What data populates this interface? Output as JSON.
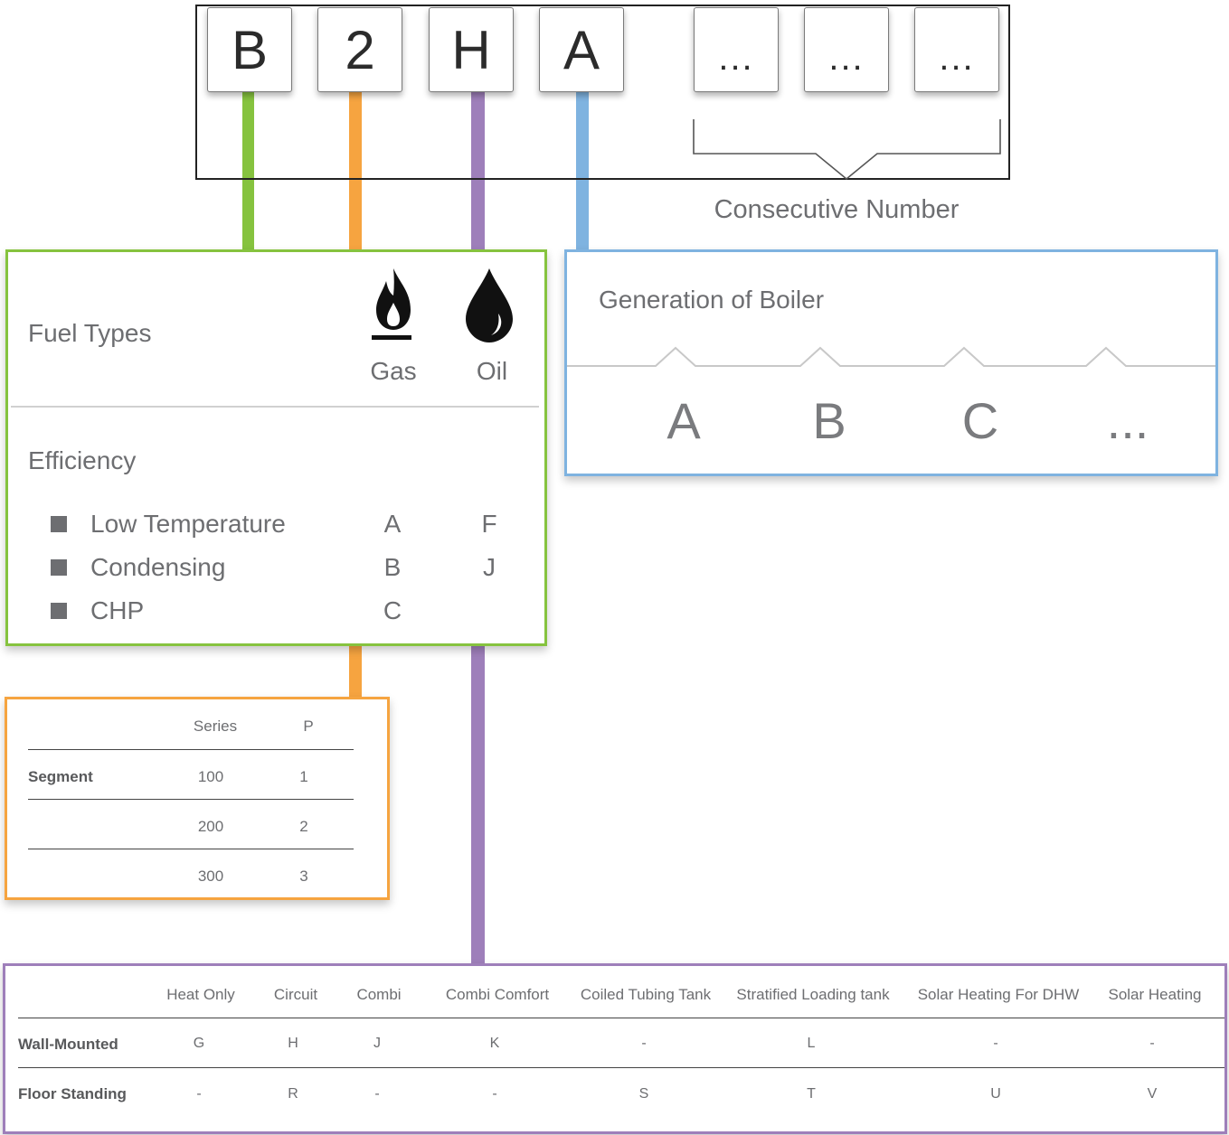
{
  "code": {
    "boxes": [
      "B",
      "2",
      "H",
      "A",
      "...",
      "...",
      "..."
    ],
    "consecutive_label": "Consecutive Number"
  },
  "colors": {
    "fuel": "#86c33f",
    "segment": "#f6a440",
    "type": "#9e7fba",
    "generation": "#7fb3e0"
  },
  "fuel": {
    "title": "Fuel Types",
    "gas_label": "Gas",
    "oil_label": "Oil",
    "gas_icon": "flame-icon",
    "oil_icon": "oil-drop-icon",
    "efficiency_title": "Efficiency",
    "rows": [
      {
        "label": "Low Temperature",
        "gas": "A",
        "oil": "F"
      },
      {
        "label": "Condensing",
        "gas": "B",
        "oil": "J"
      },
      {
        "label": "CHP",
        "gas": "C",
        "oil": ""
      }
    ]
  },
  "generation": {
    "title": "Generation of Boiler",
    "letters": [
      "A",
      "B",
      "C",
      "..."
    ]
  },
  "segment": {
    "col1": "Series",
    "col2": "P",
    "row_label": "Segment",
    "rows": [
      {
        "series": "100",
        "p": "1"
      },
      {
        "series": "200",
        "p": "2"
      },
      {
        "series": "300",
        "p": "3"
      }
    ]
  },
  "boiler_type": {
    "columns": [
      "Heat Only",
      "Circuit",
      "Combi",
      "Combi Comfort",
      "Coiled Tubing Tank",
      "Stratified Loading tank",
      "Solar Heating For DHW",
      "Solar Heating"
    ],
    "rows": [
      {
        "label": "Wall-Mounted",
        "values": [
          "G",
          "H",
          "J",
          "K",
          "-",
          "L",
          "-",
          "-"
        ]
      },
      {
        "label": "Floor Standing",
        "values": [
          "-",
          "R",
          "-",
          "-",
          "S",
          "T",
          "U",
          "V"
        ]
      }
    ]
  }
}
